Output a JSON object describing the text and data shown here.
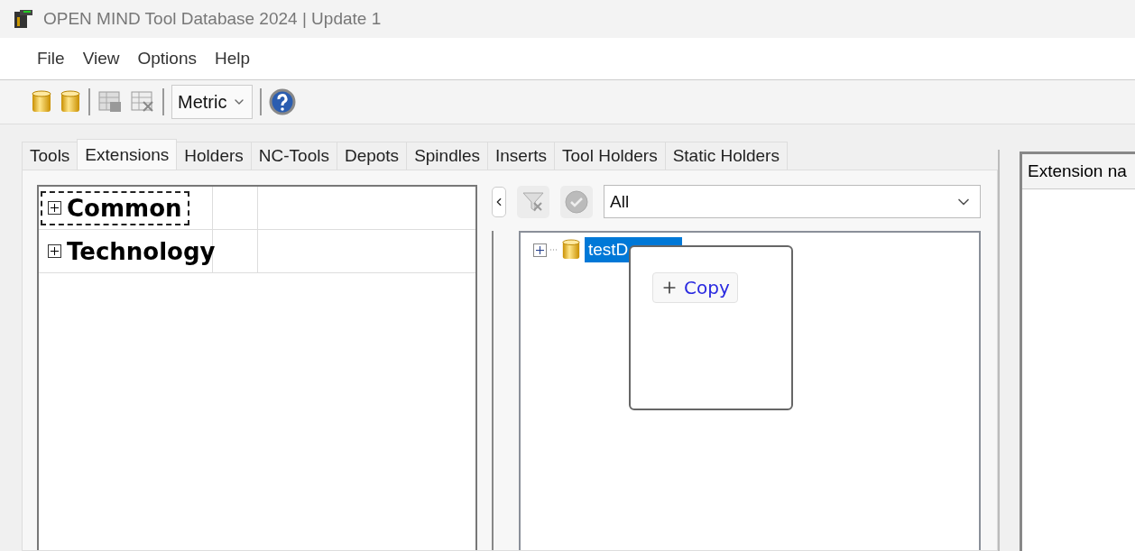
{
  "window": {
    "title": "OPEN MIND Tool Database 2024 | Update 1"
  },
  "menu": [
    "File",
    "View",
    "Options",
    "Help"
  ],
  "toolbar": {
    "units": "Metric"
  },
  "tabs": [
    {
      "label": "Tools",
      "selected": false
    },
    {
      "label": "Extensions",
      "selected": true
    },
    {
      "label": "Holders",
      "selected": false
    },
    {
      "label": "NC-Tools",
      "selected": false
    },
    {
      "label": "Depots",
      "selected": false
    },
    {
      "label": "Spindles",
      "selected": false
    },
    {
      "label": "Inserts",
      "selected": false
    },
    {
      "label": "Tool Holders",
      "selected": false
    },
    {
      "label": "Static Holders",
      "selected": false
    }
  ],
  "categories": [
    {
      "label": "Common",
      "expanded": false,
      "focused": true
    },
    {
      "label": "Technology",
      "expanded": false,
      "focused": false
    }
  ],
  "filter": {
    "value": "All"
  },
  "tree": [
    {
      "label": "testD",
      "selected": true,
      "expanded": false
    }
  ],
  "popup": {
    "action": "Copy"
  },
  "right_panel": {
    "column_header": "Extension na"
  }
}
